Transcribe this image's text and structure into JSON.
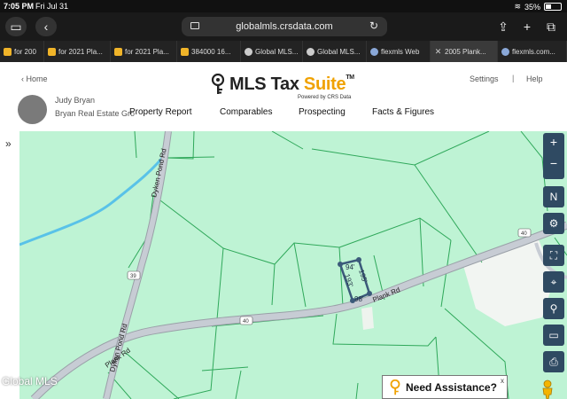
{
  "status_bar": {
    "time": "7:05 PM",
    "date": "Fri Jul 31",
    "battery": "35%",
    "battery_level": 0.35
  },
  "browser": {
    "url": "globalmls.crsdata.com",
    "tabs": [
      {
        "label": "for 200",
        "icon": "yellow",
        "active": false
      },
      {
        "label": "for 2021 Pla...",
        "icon": "yellow",
        "active": false
      },
      {
        "label": "for 2021 Pla...",
        "icon": "yellow",
        "active": false
      },
      {
        "label": "384000 16...",
        "icon": "yellow",
        "active": false
      },
      {
        "label": "Global MLS...",
        "icon": "globe",
        "active": false
      },
      {
        "label": "Global MLS...",
        "icon": "globe",
        "active": false
      },
      {
        "label": "flexmls Web",
        "icon": "blue",
        "active": false
      },
      {
        "label": "2005 Plank...",
        "icon": "close",
        "active": true
      },
      {
        "label": "flexmls.com...",
        "icon": "blue",
        "active": false
      }
    ]
  },
  "header": {
    "home": "Home",
    "logo_name": "MLS Tax ",
    "logo_suite": "Suite",
    "logo_tm": "TM",
    "logo_sub": "Powered by CRS Data",
    "settings": "Settings",
    "separator": "|",
    "help": "Help",
    "user_name": "Judy Bryan",
    "user_company": "Bryan Real Estate Gro",
    "nav": [
      "Property Report",
      "Comparables",
      "Prospecting",
      "Facts & Figures"
    ]
  },
  "map": {
    "road_labels": {
      "dyken_upper": "Dyken Pond Rd",
      "dyken_lower": "Dyken Pond Rd",
      "plank_left": "Plank Rd",
      "plank_right": "Plank Rd",
      "route_39": "39",
      "route_40_left": "40",
      "route_40_right": "40"
    },
    "dimensions": {
      "top": "94'",
      "right": "195'",
      "left": "193'",
      "bottom": "98'"
    },
    "controls": {
      "zoom_in": "+",
      "zoom_out": "−",
      "compass": "N",
      "settings": "⚙",
      "fullscreen": "⛶",
      "locate": "⌖",
      "search": "⚲",
      "measure": "▭",
      "print": "⎙"
    },
    "watermark": "Global MLS",
    "assist_text": "Need Assistance?",
    "assist_close": "x",
    "colors": {
      "land": "#bef3d4",
      "parcel": "#2fa85a",
      "road": "#c7ccd4",
      "water": "#59c2e8",
      "buildings": "#f4f6f4"
    }
  }
}
